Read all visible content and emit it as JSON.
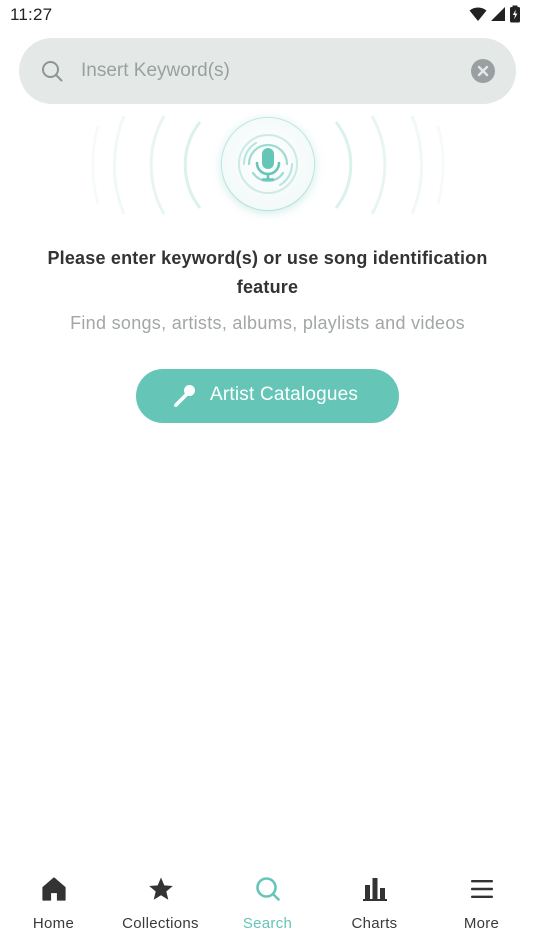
{
  "status_bar": {
    "time": "11:27",
    "icons": [
      "wifi-icon",
      "cell-signal-icon",
      "battery-icon"
    ]
  },
  "search": {
    "value": "",
    "placeholder": "Insert Keyword(s)",
    "icons": [
      "search-icon",
      "clear-icon"
    ]
  },
  "recognizer": {
    "icon": "microphone-icon"
  },
  "prompt": {
    "title": "Please enter keyword(s) or use song identification feature",
    "subtitle": "Find songs, artists, albums, playlists and videos"
  },
  "artist_button": {
    "label": "Artist Catalogues",
    "icon": "handheld-microphone-icon"
  },
  "bottom_nav": {
    "active": "Search",
    "items": [
      {
        "label": "Home",
        "icon": "home-icon"
      },
      {
        "label": "Collections",
        "icon": "star-icon"
      },
      {
        "label": "Search",
        "icon": "search-icon"
      },
      {
        "label": "Charts",
        "icon": "bar-chart-icon"
      },
      {
        "label": "More",
        "icon": "menu-icon"
      }
    ]
  },
  "colors": {
    "accent": "#65c6b8",
    "search_bg": "#e4e9e8",
    "text_primary": "#333333",
    "text_secondary": "#a2a6a7"
  }
}
